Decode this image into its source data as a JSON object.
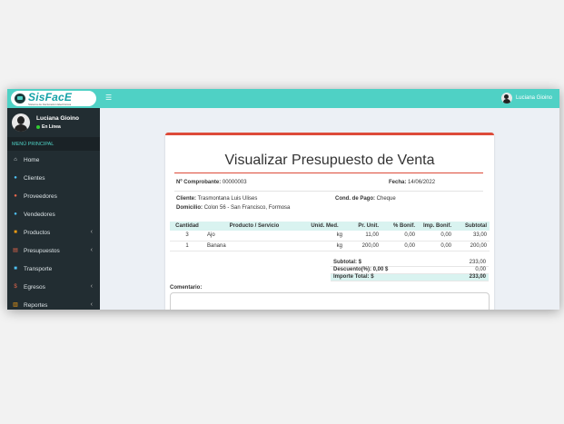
{
  "app": {
    "logo_title": "SisFacE",
    "logo_subtitle": "Sistema de Facturación Electrónica"
  },
  "user": {
    "name": "Luciana Gioino",
    "status": "En Línea"
  },
  "sidebar": {
    "header": "MENÚ PRINCIPAL",
    "items": [
      {
        "label": "Home",
        "icon": "home-icon",
        "glyph": "⌂",
        "color": "#dce3e6",
        "has_submenu": false
      },
      {
        "label": "Clientes",
        "icon": "users-icon",
        "glyph": "●",
        "color": "#4fc3f7",
        "has_submenu": false
      },
      {
        "label": "Proveedores",
        "icon": "users-icon",
        "glyph": "●",
        "color": "#e8674c",
        "has_submenu": false
      },
      {
        "label": "Vendedores",
        "icon": "users-icon",
        "glyph": "●",
        "color": "#4fc3f7",
        "has_submenu": false
      },
      {
        "label": "Productos",
        "icon": "box-icon",
        "glyph": "■",
        "color": "#f39c12",
        "has_submenu": true
      },
      {
        "label": "Presupuestos",
        "icon": "file-icon",
        "glyph": "▤",
        "color": "#e8674c",
        "has_submenu": true
      },
      {
        "label": "Transporte",
        "icon": "truck-icon",
        "glyph": "■",
        "color": "#4fc3f7",
        "has_submenu": false
      },
      {
        "label": "Egresos",
        "icon": "dollar-icon",
        "glyph": "$",
        "color": "#e8674c",
        "has_submenu": true
      },
      {
        "label": "Reportes",
        "icon": "chart-icon",
        "glyph": "▥",
        "color": "#f39c12",
        "has_submenu": true
      }
    ]
  },
  "topbar": {
    "user_name": "Luciana Gioino"
  },
  "document": {
    "title": "Visualizar Presupuesto de Venta",
    "comprobante_label": "Nº Comprobante:",
    "comprobante_value": "00000003",
    "fecha_label": "Fecha:",
    "fecha_value": "14/06/2022",
    "cliente_label": "Cliente:",
    "cliente_value": "Trasmontana Luis Ulises",
    "domicilio_label": "Domicilio:",
    "domicilio_value": "Colon 56 - San Francisco, Formosa",
    "cond_pago_label": "Cond. de Pago:",
    "cond_pago_value": "Cheque"
  },
  "items_table": {
    "headers": [
      "Cantidad",
      "Producto / Servicio",
      "Unid. Med.",
      "Pr. Unit.",
      "% Bonif.",
      "Imp. Bonif.",
      "Subtotal"
    ],
    "rows": [
      [
        "3",
        "Ajo",
        "kg",
        "11,00",
        "0,00",
        "0,00",
        "33,00"
      ],
      [
        "1",
        "Banana",
        "kg",
        "200,00",
        "0,00",
        "0,00",
        "200,00"
      ]
    ]
  },
  "totals": [
    {
      "label": "Subtotal: $",
      "value": "233,00"
    },
    {
      "label": "Descuento(%): 0,00 $",
      "value": "0,00"
    },
    {
      "label": "Importe Total: $",
      "value": "233,00"
    }
  ],
  "comment": {
    "label": "Comentario:"
  },
  "colors": {
    "accent": "#4fd1c5",
    "sidebar": "#222d32",
    "card_border": "#dd4b39"
  }
}
